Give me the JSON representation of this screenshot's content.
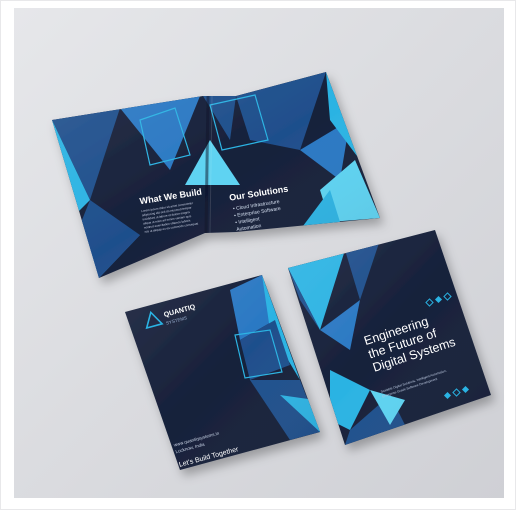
{
  "palette": {
    "backdrop": "#dcdde1",
    "navy": "#16203a",
    "navy_dark": "#0f1830",
    "blue": "#1f4f8c",
    "cyan": "#2bb3e3",
    "light_cyan": "#5ed3f2",
    "mid_blue": "#2a78c3"
  },
  "open_brochure": {
    "left_heading": "What We Build",
    "left_body_lines": [
      "Lorem ipsum dolor sit amet consectetur",
      "adipiscing elit sed do eiusmod tempor",
      "incididunt ut labore et dolore magna",
      "aliqua ut enim ad minim veniam quis",
      "nostrud exercitation ullamco laboris",
      "nisi ut aliquip ex ea commodo consequat"
    ],
    "right_heading": "Our Solutions",
    "right_items": [
      "• Cloud Infrastructure",
      "• Enterprise Software",
      "• Intelligent",
      "  Automation"
    ]
  },
  "back_cover": {
    "brand_name": "QUANTIQ",
    "brand_sub": "SYSTEMS",
    "contact_lines": [
      "www.quantiqsystems.in",
      "Lucknow, India"
    ],
    "tagline": "Let's Build Together"
  },
  "front_cover": {
    "headline_lines": [
      "Engineering",
      "the Future of",
      "Digital Systems"
    ],
    "subtext_lines": [
      "Scalable Digital Solutions, Intelligent Automation,",
      "Enterprise-Grade Software Development"
    ]
  }
}
